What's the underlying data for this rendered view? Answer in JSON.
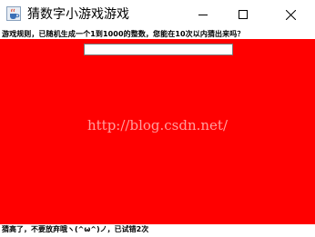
{
  "window": {
    "title": "猜数字小游戏游戏",
    "icon": "java-cup-icon"
  },
  "controls": {
    "minimize_icon": "minimize-icon",
    "maximize_icon": "maximize-icon",
    "close_icon": "close-icon"
  },
  "instruction": "游戏规则，已随机生成一个1到1000的整数，您能在10次以内猜出来吗？",
  "input": {
    "value": "",
    "placeholder": ""
  },
  "watermark": "http://blog.csdn.net/",
  "status": "猜高了，不要放弃哦ヽ(^ω^)ノ，已试错2次",
  "colors": {
    "content_background": "#ff0000",
    "window_background": "#ffffff"
  }
}
